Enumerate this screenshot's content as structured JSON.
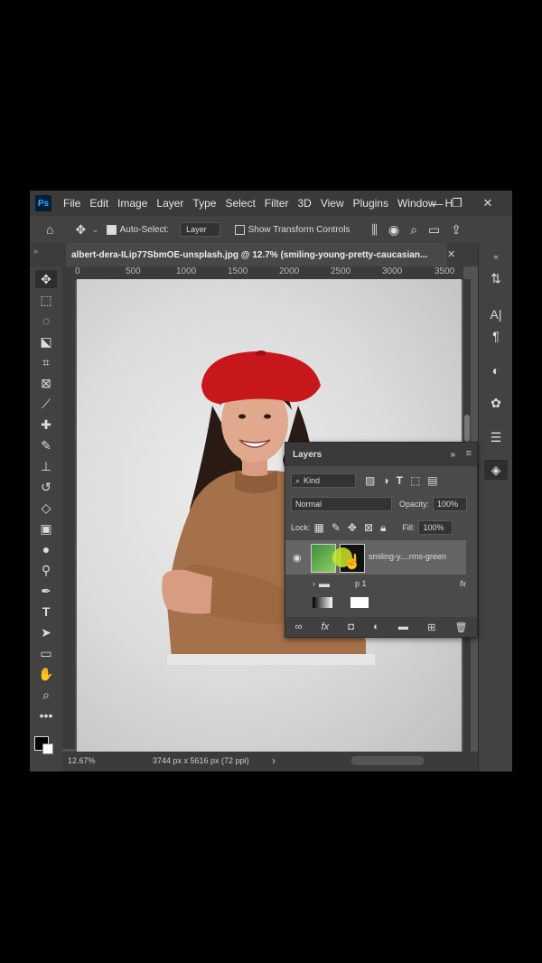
{
  "app": {
    "logo": "Ps",
    "menu": [
      "File",
      "Edit",
      "Image",
      "Layer",
      "Type",
      "Select",
      "Filter",
      "3D",
      "View",
      "Plugins",
      "Window",
      "H"
    ],
    "window_controls": {
      "minimize": "—",
      "restore": "❐",
      "close": "✕"
    }
  },
  "options_bar": {
    "auto_select_label": "Auto-Select:",
    "auto_select_value": "Layer",
    "show_transform_label": "Show Transform Controls"
  },
  "document": {
    "tab_title": "albert-dera-ILip77SbmOE-unsplash.jpg @ 12.7% (smiling-young-pretty-caucasian...",
    "close": "✕"
  },
  "ruler": {
    "ticks": [
      "0",
      "500",
      "1000",
      "1500",
      "2000",
      "2500",
      "3000",
      "3500"
    ]
  },
  "status": {
    "zoom": "12.67%",
    "doc_size": "3744 px x 5616 px (72 ppi)",
    "arrow": "›"
  },
  "layers_panel": {
    "title": "Layers",
    "filter_kind": "Kind",
    "blend_mode": "Normal",
    "opacity_label": "Opacity:",
    "opacity_value": "100%",
    "lock_label": "Lock:",
    "fill_label": "Fill:",
    "fill_value": "100%",
    "layer_name": "smiling-y....rms-green",
    "group_name": "p 1",
    "fx_label": "fx"
  },
  "colors": {
    "menubar": "#3a3a3a",
    "panel": "#424242",
    "workspace": "#535353",
    "accent_ps": "#31a8ff",
    "beret": "#c8161d",
    "sweater": "#a5714a"
  },
  "icons": [
    "home-icon",
    "move-icon",
    "marquee-icon",
    "lasso-icon",
    "object-select-icon",
    "crop-icon",
    "frame-icon",
    "eyedropper-icon",
    "healing-icon",
    "brush-icon",
    "stamp-icon",
    "history-brush-icon",
    "eraser-icon",
    "gradient-icon",
    "blur-icon",
    "dodge-icon",
    "pen-icon",
    "type-icon",
    "path-select-icon",
    "rectangle-icon",
    "hand-icon",
    "zoom-icon",
    "more-icon",
    "eye-icon",
    "folder-icon"
  ]
}
